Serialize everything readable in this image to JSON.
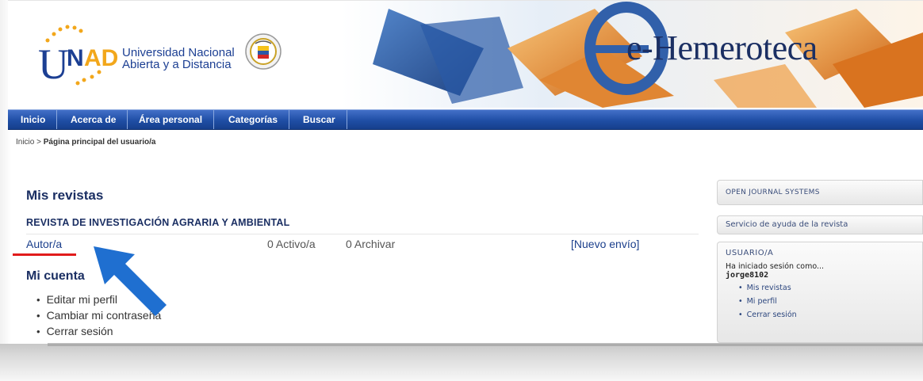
{
  "header": {
    "logo_brand": "UNAD",
    "logo_line1": "Universidad Nacional",
    "logo_line2": "Abierta y a Distancia",
    "banner_title": "e-Hemeroteca"
  },
  "nav": {
    "items": [
      {
        "label": "Inicio"
      },
      {
        "label": "Acerca de"
      },
      {
        "label": "Área personal"
      },
      {
        "label": "Categorías"
      },
      {
        "label": "Buscar"
      }
    ]
  },
  "breadcrumb": {
    "home": "Inicio",
    "separator": ">",
    "current": "Página principal del usuario/a"
  },
  "main": {
    "journals_heading": "Mis revistas",
    "journal_name": "REVISTA DE INVESTIGACIÓN AGRARIA Y AMBIENTAL",
    "role": "Autor/a",
    "active": "0 Activo/a",
    "archive": "0 Archivar",
    "new_submission": "[Nuevo envío]",
    "account_heading": "Mi cuenta",
    "account_links": [
      "Editar mi perfil",
      "Cambiar mi contraseña",
      "Cerrar sesión"
    ]
  },
  "sidebar": {
    "ojs": "OPEN JOURNAL SYSTEMS",
    "help": "Servicio de ayuda de la revista",
    "user_title": "USUARIO/A",
    "user_status": "Ha iniciado sesión como...",
    "username": "jorge8102",
    "user_links": [
      "Mis revistas",
      "Mi perfil",
      "Cerrar sesión"
    ]
  },
  "colors": {
    "nav_blue": "#1f4ea5",
    "heading_blue": "#1b2f63",
    "annotation_red": "#e11b1b",
    "annotation_arrow": "#1f6fd0"
  }
}
